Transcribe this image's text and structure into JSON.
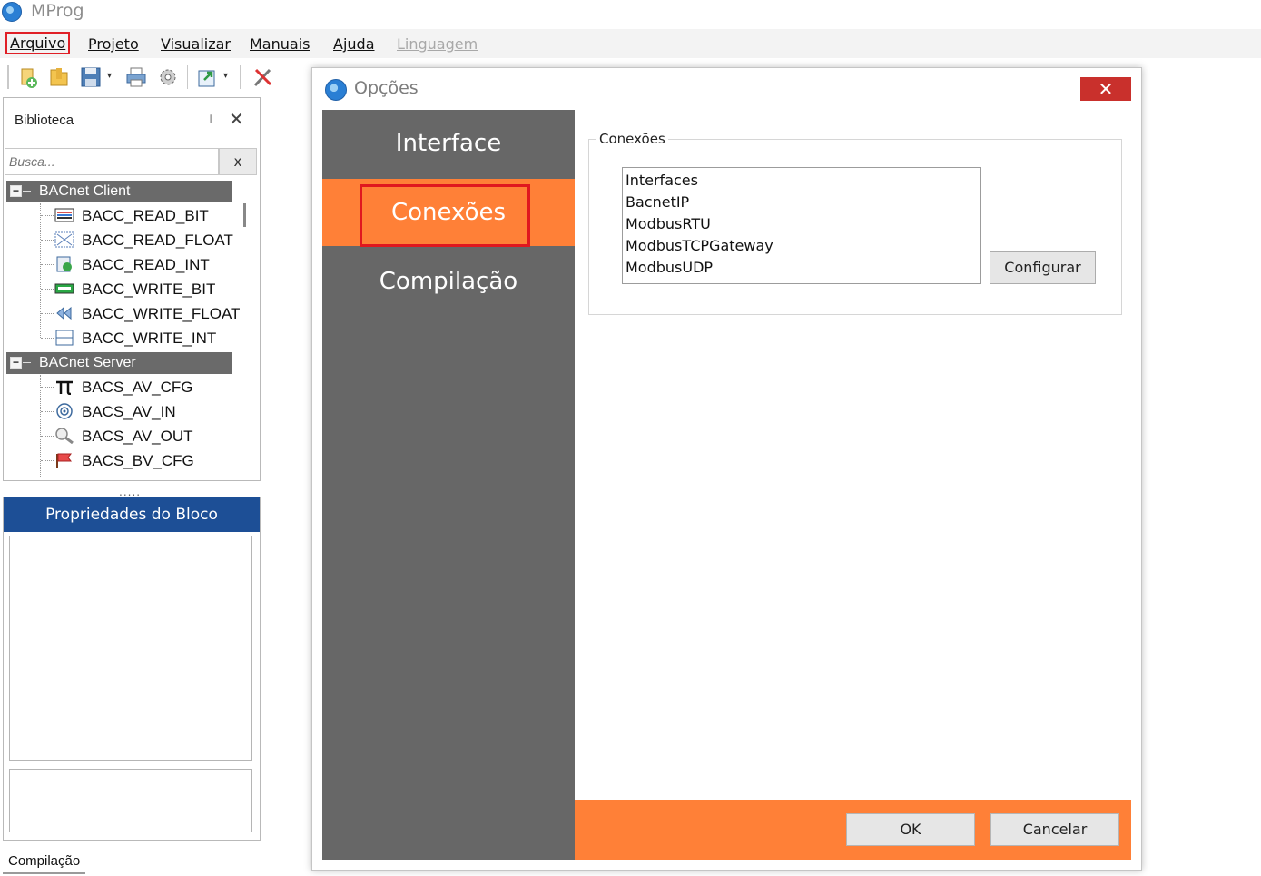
{
  "app": {
    "title": "MProg"
  },
  "menu": {
    "items": [
      {
        "label": "Arquivo",
        "enabled": true
      },
      {
        "label": "Projeto",
        "enabled": true
      },
      {
        "label": "Visualizar",
        "enabled": true
      },
      {
        "label": "Manuais",
        "enabled": true
      },
      {
        "label": "Ajuda",
        "enabled": true
      },
      {
        "label": "Linguagem",
        "enabled": false
      }
    ]
  },
  "toolbar": {
    "icons": [
      "new-project-icon",
      "open-folder-icon",
      "save-icon",
      "print-icon",
      "settings-gear-icon",
      "export-icon",
      "tools-icon"
    ]
  },
  "library": {
    "title": "Biblioteca",
    "pin_glyph": "⊥",
    "close_glyph": "✕",
    "search": {
      "placeholder": "Busca...",
      "clear_label": "x"
    },
    "groups": [
      {
        "label": "BACnet Client",
        "toggle": "−",
        "items": [
          {
            "label": "BACC_READ_BIT",
            "icon": "read-bit-icon"
          },
          {
            "label": "BACC_READ_FLOAT",
            "icon": "read-float-icon"
          },
          {
            "label": "BACC_READ_INT",
            "icon": "read-int-icon"
          },
          {
            "label": "BACC_WRITE_BIT",
            "icon": "write-bit-icon"
          },
          {
            "label": "BACC_WRITE_FLOAT",
            "icon": "write-float-icon"
          },
          {
            "label": "BACC_WRITE_INT",
            "icon": "write-int-icon"
          }
        ]
      },
      {
        "label": "BACnet Server",
        "toggle": "−",
        "items": [
          {
            "label": "BACS_AV_CFG",
            "icon": "pi-icon"
          },
          {
            "label": "BACS_AV_IN",
            "icon": "antenna-icon"
          },
          {
            "label": "BACS_AV_OUT",
            "icon": "magnifier-icon"
          },
          {
            "label": "BACS_BV_CFG",
            "icon": "flag-icon"
          }
        ]
      }
    ],
    "splitter": "....."
  },
  "properties": {
    "title": "Propriedades do Bloco"
  },
  "bottom_tabs": {
    "compilacao": "Compilação"
  },
  "dialog": {
    "title": "Opções",
    "close_glyph": "✕",
    "nav": [
      {
        "label": "Interface",
        "selected": false
      },
      {
        "label": "Conexões",
        "selected": true
      },
      {
        "label": "Compilação",
        "selected": false
      }
    ],
    "group_title": "Conexões",
    "connections": [
      "Interfaces",
      "BacnetIP",
      "ModbusRTU",
      "ModbusTCPGateway",
      "ModbusUDP"
    ],
    "configure_label": "Configurar",
    "ok_label": "OK",
    "cancel_label": "Cancelar"
  },
  "colors": {
    "accent_orange": "#ff8037",
    "nav_gray": "#676767",
    "props_header_blue": "#1d4f96",
    "highlight_red": "#e0181f",
    "close_red": "#c9302c"
  }
}
